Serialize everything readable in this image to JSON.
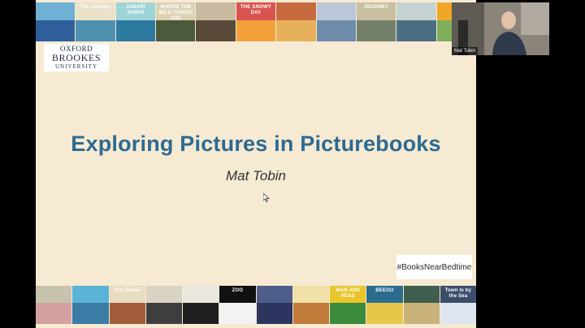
{
  "slide": {
    "background": "#f6ead3",
    "title": "Exploring Pictures in Picturebooks",
    "title_color": "#2d6a93",
    "subtitle": "Mat Tobin",
    "hashtag": "#BooksNearBedtime",
    "logo": {
      "line1": "OXFORD",
      "line2": "BROOKES",
      "line3": "UNIVERSITY"
    }
  },
  "top_covers": [
    {
      "label": "",
      "bg": "#6fb2d6",
      "art": "#2f5f9a"
    },
    {
      "label": "The Journey",
      "bg": "#e9e2c8",
      "art": "#4f8fb0"
    },
    {
      "label": "JABARI JUMPS",
      "bg": "#9ed3d7",
      "art": "#2c7aa0"
    },
    {
      "label": "WHERE THE WILD THINGS ARE",
      "bg": "#dcd2b3",
      "art": "#4c5a3c"
    },
    {
      "label": "",
      "bg": "#c8b9a0",
      "art": "#5a4a3a"
    },
    {
      "label": "THE SNOWY DAY",
      "bg": "#d9534f",
      "art": "#f2a13a"
    },
    {
      "label": "",
      "bg": "#c86a3f",
      "art": "#e6b15a"
    },
    {
      "label": "",
      "bg": "#b9c7d8",
      "art": "#6d8caa"
    },
    {
      "label": "JOURNEY",
      "bg": "#c9c0a2",
      "art": "#75806a"
    },
    {
      "label": "",
      "bg": "#c6d2cf",
      "art": "#4b6f82"
    },
    {
      "label": "",
      "bg": "#f1a629",
      "art": "#7fae5a"
    }
  ],
  "bottom_covers": [
    {
      "label": "",
      "bg": "#c7c3ad",
      "art": "#d4a0a0"
    },
    {
      "label": "",
      "bg": "#59b4d8",
      "art": "#3a7ca6"
    },
    {
      "label": "The Tunnel",
      "bg": "#e8dcc2",
      "art": "#a35c3a"
    },
    {
      "label": "",
      "bg": "#d9d3c2",
      "art": "#3e3e3e"
    },
    {
      "label": "",
      "bg": "#ebe7df",
      "art": "#1f1f1f"
    },
    {
      "label": "ZOO",
      "bg": "#111111",
      "art": "#f2f2f2"
    },
    {
      "label": "",
      "bg": "#4e5d8a",
      "art": "#2b3560"
    },
    {
      "label": "",
      "bg": "#efe0a6",
      "art": "#c07a3a"
    },
    {
      "label": "WAR AND PEAS",
      "bg": "#e9c52b",
      "art": "#3c8a3c"
    },
    {
      "label": "BEEGU",
      "bg": "#2b6c8f",
      "art": "#e8c64a"
    },
    {
      "label": "",
      "bg": "#3f5e4e",
      "art": "#c9b27a"
    },
    {
      "label": "Town Is by the Sea",
      "bg": "#3b4d6a",
      "art": "#e0e6ef"
    }
  ],
  "video": {
    "participant_name": "Mat Tobin"
  }
}
